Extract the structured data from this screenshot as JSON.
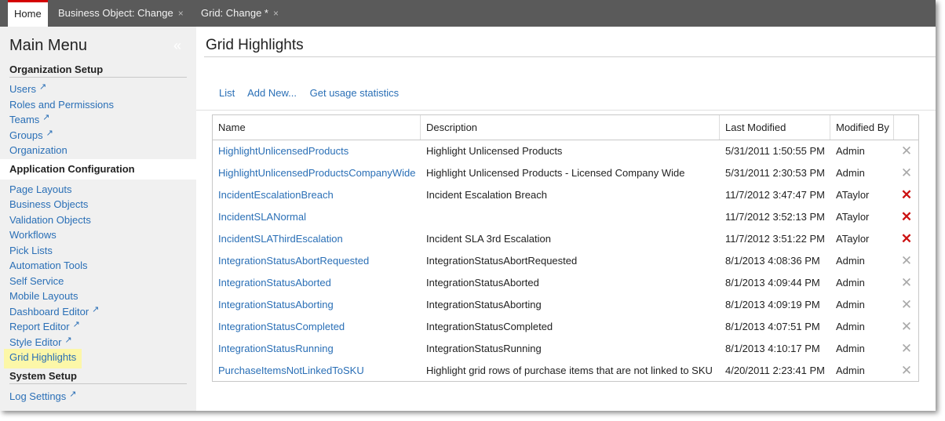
{
  "tabs": [
    {
      "label": "Home",
      "closable": false,
      "active": true
    },
    {
      "label": "Business Object: Change",
      "closable": true,
      "active": false
    },
    {
      "label": "Grid: Change *",
      "closable": true,
      "active": false
    }
  ],
  "sidebar": {
    "title": "Main Menu",
    "sections": [
      {
        "heading": "Organization Setup",
        "items": [
          {
            "label": "Users",
            "external": true
          },
          {
            "label": "Roles and Permissions",
            "external": false
          },
          {
            "label": "Teams",
            "external": true
          },
          {
            "label": "Groups",
            "external": true
          },
          {
            "label": "Organization",
            "external": false
          }
        ]
      },
      {
        "heading": "Application Configuration",
        "items": [
          {
            "label": "Page Layouts",
            "external": false
          },
          {
            "label": "Business Objects",
            "external": false
          },
          {
            "label": "Validation Objects",
            "external": false
          },
          {
            "label": "Workflows",
            "external": false
          },
          {
            "label": "Pick Lists",
            "external": false
          },
          {
            "label": "Automation Tools",
            "external": false
          },
          {
            "label": "Self Service",
            "external": false
          },
          {
            "label": "Mobile Layouts",
            "external": false
          },
          {
            "label": "Dashboard Editor",
            "external": true
          },
          {
            "label": "Report Editor",
            "external": true
          },
          {
            "label": "Style Editor",
            "external": true
          },
          {
            "label": "Grid Highlights",
            "external": false,
            "selected": true
          }
        ]
      },
      {
        "heading": "System Setup",
        "items": [
          {
            "label": "Log Settings",
            "external": true
          }
        ]
      }
    ]
  },
  "main": {
    "title": "Grid Highlights",
    "actions": [
      "List",
      "Add New...",
      "Get usage statistics"
    ],
    "grid": {
      "columns": [
        "Name",
        "Description",
        "Last Modified",
        "Modified By"
      ],
      "rows": [
        {
          "name": "HighlightUnlicensedProducts",
          "description": "Highlight Unlicensed Products",
          "modified": "5/31/2011 1:50:55 PM",
          "by": "Admin",
          "deletable": false
        },
        {
          "name": "HighlightUnlicensedProductsCompanyWide",
          "description": "Highlight Unlicensed Products - Licensed Company Wide",
          "modified": "5/31/2011 2:30:53 PM",
          "by": "Admin",
          "deletable": false
        },
        {
          "name": "IncidentEscalationBreach",
          "description": "Incident Escalation Breach",
          "modified": "11/7/2012 3:47:47 PM",
          "by": "ATaylor",
          "deletable": true
        },
        {
          "name": "IncidentSLANormal",
          "description": "",
          "modified": "11/7/2012 3:52:13 PM",
          "by": "ATaylor",
          "deletable": true
        },
        {
          "name": "IncidentSLAThirdEscalation",
          "description": "Incident SLA 3rd Escalation",
          "modified": "11/7/2012 3:51:22 PM",
          "by": "ATaylor",
          "deletable": true
        },
        {
          "name": "IntegrationStatusAbortRequested",
          "description": "IntegrationStatusAbortRequested",
          "modified": "8/1/2013 4:08:36 PM",
          "by": "Admin",
          "deletable": false
        },
        {
          "name": "IntegrationStatusAborted",
          "description": "IntegrationStatusAborted",
          "modified": "8/1/2013 4:09:44 PM",
          "by": "Admin",
          "deletable": false
        },
        {
          "name": "IntegrationStatusAborting",
          "description": "IntegrationStatusAborting",
          "modified": "8/1/2013 4:09:19 PM",
          "by": "Admin",
          "deletable": false
        },
        {
          "name": "IntegrationStatusCompleted",
          "description": "IntegrationStatusCompleted",
          "modified": "8/1/2013 4:07:51 PM",
          "by": "Admin",
          "deletable": false
        },
        {
          "name": "IntegrationStatusRunning",
          "description": "IntegrationStatusRunning",
          "modified": "8/1/2013 4:10:17 PM",
          "by": "Admin",
          "deletable": false
        },
        {
          "name": "PurchaseItemsNotLinkedToSKU",
          "description": "Highlight grid rows of purchase items that are not linked to SKU",
          "modified": "4/20/2011 2:23:41 PM",
          "by": "Admin",
          "deletable": false
        }
      ]
    }
  },
  "icons": {
    "close": "×",
    "collapse": "«",
    "external": "↗",
    "delete": "✕"
  },
  "colors": {
    "tabbar": "#5a5a5a",
    "active_tab_accent": "#d40000",
    "link": "#2a6fb6",
    "delete_enabled": "#cc1111",
    "delete_disabled": "#a8a8a8",
    "selected_highlight": "#fcf7a8"
  }
}
